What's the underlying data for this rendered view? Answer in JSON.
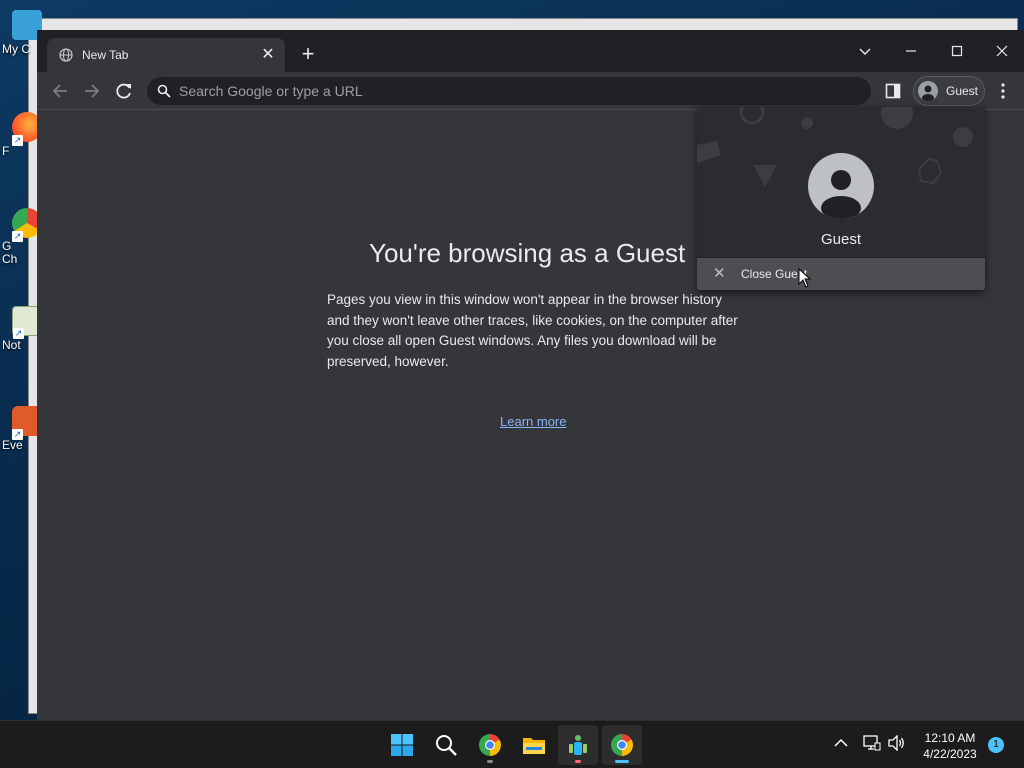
{
  "desktop": {
    "icons": [
      {
        "label": "My C",
        "name": "desktop-icon-my-computer",
        "icon": "monitor-icon",
        "color": "#3aa0d8"
      },
      {
        "label": "F",
        "name": "desktop-icon-firefox",
        "icon": "firefox-icon",
        "color": "#ff7139"
      },
      {
        "label": "G\nCh",
        "name": "desktop-icon-google-chrome",
        "icon": "chrome-icon",
        "color": "#34a853"
      },
      {
        "label": "Not",
        "name": "desktop-icon-notepad",
        "icon": "notepad-icon",
        "color": "#c8e6c9"
      },
      {
        "label": "Eve",
        "name": "desktop-icon-eve",
        "icon": "app-icon",
        "color": "#e05a2a"
      }
    ]
  },
  "browser": {
    "tab": {
      "title": "New Tab",
      "icon": "globe-icon",
      "close_icon": "close-icon"
    },
    "new_tab_icon": "plus-icon",
    "window_controls": [
      "chevron-down-icon",
      "minimize-icon",
      "maximize-icon",
      "close-icon"
    ],
    "omnibox": {
      "placeholder": "Search Google or type a URL",
      "value": ""
    },
    "profile_chip": {
      "label": "Guest"
    },
    "page": {
      "heading": "You're browsing as a Guest",
      "body": "Pages you view in this window won't appear in the browser history and they won't leave other traces, like cookies, on the computer after you close all open Guest windows. Any files you download will be preserved, however.",
      "learn_more": "Learn more"
    }
  },
  "profile_menu": {
    "name": "Guest",
    "close_label": "Close Guest"
  },
  "taskbar": {
    "apps": [
      "windows-start-icon",
      "search-icon",
      "chrome-icon",
      "file-explorer-icon",
      "app-icon",
      "chrome-icon"
    ],
    "time": "12:10 AM",
    "date": "4/22/2023",
    "notifications": "1"
  },
  "colors": {
    "chrome_bg": "#35363a",
    "titlebar": "#202124",
    "text": "#e8eaed",
    "link": "#8ab4f8",
    "accent": "#4cc2ff"
  }
}
